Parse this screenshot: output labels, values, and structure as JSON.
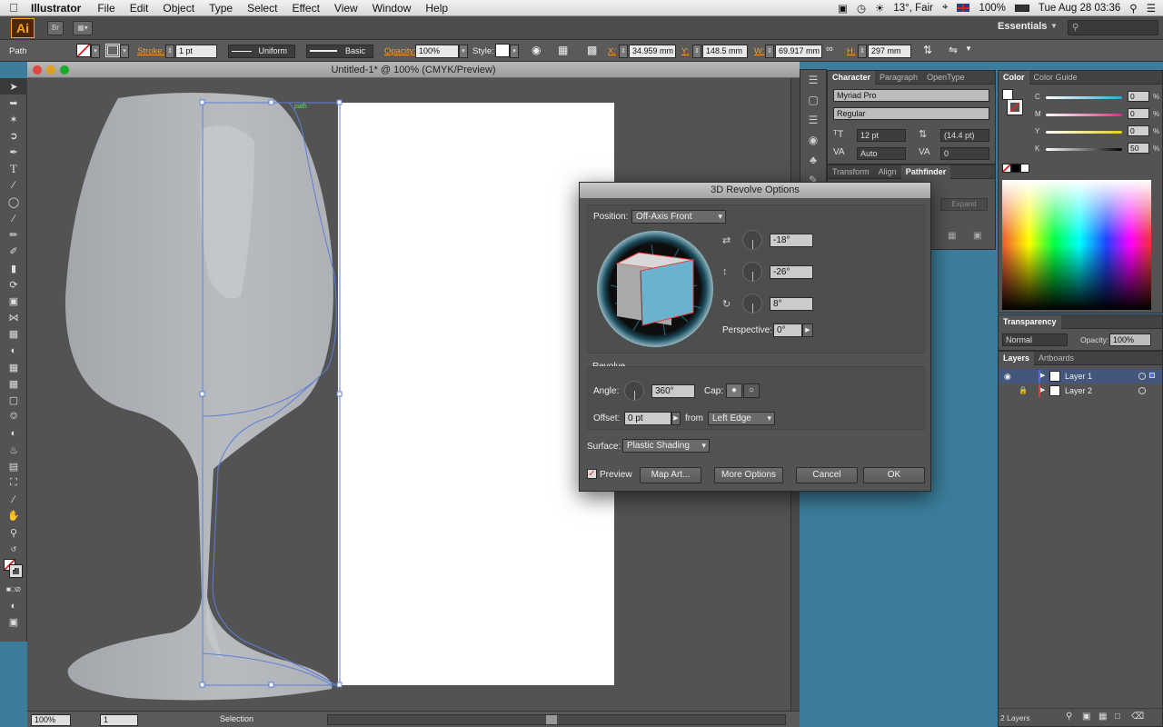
{
  "menubar": {
    "app": "Illustrator",
    "items": [
      "File",
      "Edit",
      "Object",
      "Type",
      "Select",
      "Effect",
      "View",
      "Window",
      "Help"
    ],
    "weather": "13°, Fair",
    "battery": "100%",
    "clock": "Tue Aug 28  03:36"
  },
  "appbar": {
    "logo": "Ai",
    "br": "Br",
    "workspace": "Essentials"
  },
  "controlbar": {
    "selection": "Path",
    "stroke_label": "Stroke:",
    "stroke_value": "1 pt",
    "profile": "Uniform",
    "brush": "Basic",
    "opacity_label": "Opacity:",
    "opacity": "100%",
    "style_label": "Style:",
    "x_label": "X:",
    "x": "34.959 mm",
    "y_label": "Y:",
    "y": "148.5 mm",
    "w_label": "W:",
    "w": "69.917 mm",
    "h_label": "H:",
    "h": "297 mm"
  },
  "document": {
    "title": "Untitled-1* @ 100% (CMYK/Preview)",
    "path_label": "path",
    "zoom": "100%",
    "artboard_num": "1",
    "status": "Selection"
  },
  "character_panel": {
    "tabs": [
      "Character",
      "Paragraph",
      "OpenType"
    ],
    "font": "Myriad Pro",
    "style": "Regular",
    "size": "12 pt",
    "leading": "(14.4 pt)",
    "kerning": "Auto",
    "tracking": "0"
  },
  "transform_panel": {
    "tabs": [
      "Transform",
      "Align",
      "Pathfinder"
    ],
    "expand": "Expand"
  },
  "color_panel": {
    "tabs": [
      "Color",
      "Color Guide"
    ],
    "channels": [
      {
        "name": "C",
        "value": "0",
        "color": "#31a6d6"
      },
      {
        "name": "M",
        "value": "0",
        "color": "#d0327a"
      },
      {
        "name": "Y",
        "value": "0",
        "color": "#e0d020"
      },
      {
        "name": "K",
        "value": "50",
        "color": "#888888"
      }
    ],
    "pct": "%"
  },
  "transparency_panel": {
    "title": "Transparency",
    "mode": "Normal",
    "opacity_label": "Opacity:",
    "opacity": "100%"
  },
  "layers_panel": {
    "tabs": [
      "Layers",
      "Artboards"
    ],
    "layers": [
      {
        "name": "Layer 1",
        "color": "#4f6fe0"
      },
      {
        "name": "Layer 2",
        "color": "#e04040"
      }
    ],
    "count": "2 Layers"
  },
  "dialog": {
    "title": "3D Revolve Options",
    "position_label": "Position:",
    "position": "Off-Axis Front",
    "rot_x": "-18°",
    "rot_y": "-26°",
    "rot_z": "8°",
    "perspective_label": "Perspective:",
    "perspective": "0°",
    "revolve_header": "Revolve",
    "angle_label": "Angle:",
    "angle": "360°",
    "cap_label": "Cap:",
    "offset_label": "Offset:",
    "offset": "0 pt",
    "from_label": "from",
    "from": "Left Edge",
    "surface_label": "Surface:",
    "surface": "Plastic Shading",
    "preview_label": "Preview",
    "preview_checked": true,
    "map_art": "Map Art...",
    "more_options": "More Options",
    "cancel": "Cancel",
    "ok": "OK"
  }
}
